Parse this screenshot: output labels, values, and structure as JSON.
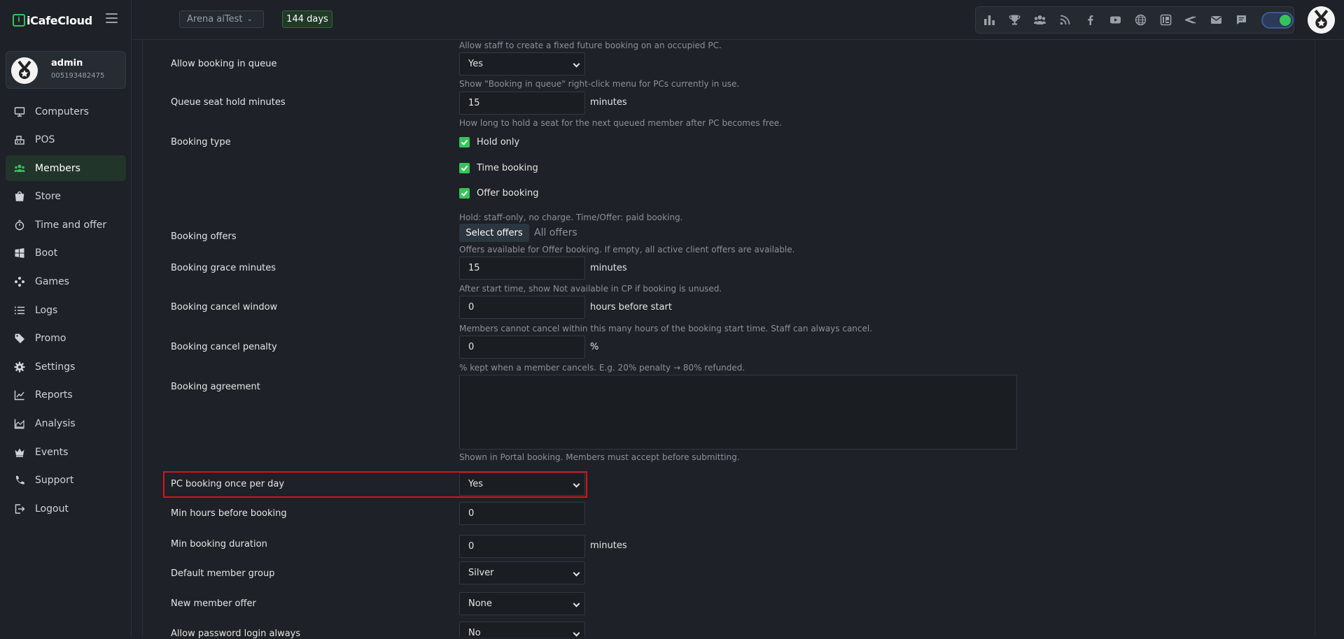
{
  "brand": {
    "name": "iCafeCloud",
    "logo_mark": "i"
  },
  "user": {
    "name": "admin",
    "id": "005193482475"
  },
  "sidebar": {
    "items": [
      {
        "label": "Computers",
        "icon": "monitor-icon",
        "active": false
      },
      {
        "label": "POS",
        "icon": "cash-register-icon",
        "active": false
      },
      {
        "label": "Members",
        "icon": "users-icon",
        "active": true
      },
      {
        "label": "Store",
        "icon": "shopping-bag-icon",
        "active": false
      },
      {
        "label": "Time and offer",
        "icon": "stopwatch-icon",
        "active": false
      },
      {
        "label": "Boot",
        "icon": "windows-icon",
        "active": false
      },
      {
        "label": "Games",
        "icon": "gamepad-icon",
        "active": false
      },
      {
        "label": "Logs",
        "icon": "list-icon",
        "active": false
      },
      {
        "label": "Promo",
        "icon": "tag-icon",
        "active": false
      },
      {
        "label": "Settings",
        "icon": "gear-icon",
        "active": false
      },
      {
        "label": "Reports",
        "icon": "line-chart-icon",
        "active": false
      },
      {
        "label": "Analysis",
        "icon": "area-chart-icon",
        "active": false
      },
      {
        "label": "Events",
        "icon": "crown-icon",
        "active": false
      },
      {
        "label": "Support",
        "icon": "phone-icon",
        "active": false
      },
      {
        "label": "Logout",
        "icon": "logout-icon",
        "active": false
      }
    ]
  },
  "topbar": {
    "cafe_name": "Arena aiTest",
    "days_left": "144 days",
    "toolbar_icons": [
      "leaderboard-icon",
      "trophy-icon",
      "group-icon",
      "rss-icon",
      "facebook-icon",
      "youtube-icon",
      "globe-icon",
      "icafe-icon",
      "double-chevron-icon",
      "mail-icon",
      "chat-icon"
    ],
    "toggle_on": true
  },
  "form": {
    "fixed_booking_hint": "Allow staff to create a fixed future booking on an occupied PC.",
    "booking_in_queue": {
      "label": "Allow booking in queue",
      "value": "Yes",
      "hint": "Show \"Booking in queue\" right-click menu for PCs currently in use."
    },
    "queue_seat_hold": {
      "label": "Queue seat hold minutes",
      "value": "15",
      "unit": "minutes",
      "hint": "How long to hold a seat for the next queued member after PC becomes free."
    },
    "booking_type": {
      "label": "Booking type",
      "options": [
        {
          "label": "Hold only",
          "checked": true
        },
        {
          "label": "Time booking",
          "checked": true
        },
        {
          "label": "Offer booking",
          "checked": true
        }
      ],
      "hint": "Hold: staff-only, no charge. Time/Offer: paid booking."
    },
    "booking_offers": {
      "label": "Booking offers",
      "button": "Select offers",
      "value": "All offers",
      "hint": "Offers available for Offer booking. If empty, all active client offers are available."
    },
    "booking_grace": {
      "label": "Booking grace minutes",
      "value": "15",
      "unit": "minutes",
      "hint": "After start time, show Not available in CP if booking is unused."
    },
    "booking_cancel_window": {
      "label": "Booking cancel window",
      "value": "0",
      "unit": "hours before start",
      "hint": "Members cannot cancel within this many hours of the booking start time. Staff can always cancel."
    },
    "booking_cancel_penalty": {
      "label": "Booking cancel penalty",
      "value": "0",
      "unit": "%",
      "hint": "% kept when a member cancels. E.g. 20% penalty → 80% refunded."
    },
    "booking_agreement": {
      "label": "Booking agreement",
      "value": "",
      "hint": "Shown in Portal booking. Members must accept before submitting."
    },
    "pc_booking_once": {
      "label": "PC booking once per day",
      "value": "Yes"
    },
    "min_hours_before": {
      "label": "Min hours before booking",
      "value": "0"
    },
    "min_booking_duration": {
      "label": "Min booking duration",
      "value": "0",
      "unit": "minutes"
    },
    "default_member_group": {
      "label": "Default member group",
      "value": "Silver"
    },
    "new_member_offer": {
      "label": "New member offer",
      "value": "None"
    },
    "allow_password_login": {
      "label": "Allow password login always",
      "value": "No"
    }
  },
  "colors": {
    "accent": "#35c45a",
    "highlight": "#d8141b",
    "background": "#1e2127"
  }
}
